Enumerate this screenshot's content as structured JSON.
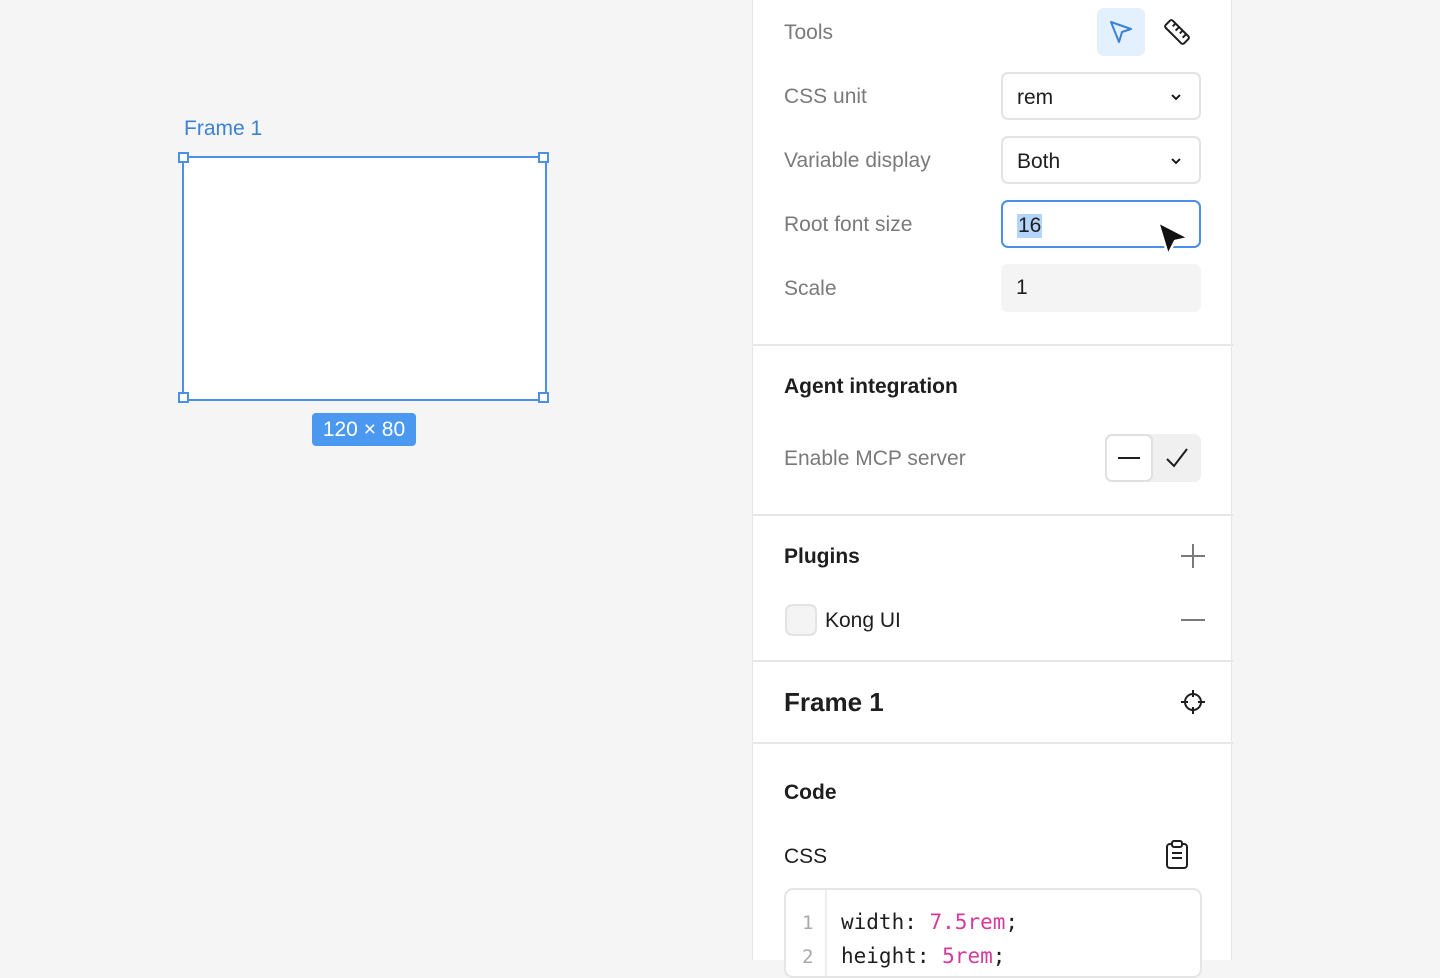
{
  "canvas": {
    "frame_label": "Frame 1",
    "dimensions_badge": "120 × 80"
  },
  "panel": {
    "tools": {
      "label": "Tools",
      "active_tool": "cursor-icon",
      "tools": [
        "cursor-icon",
        "ruler-icon"
      ]
    },
    "css_unit": {
      "label": "CSS unit",
      "value": "rem"
    },
    "variable_display": {
      "label": "Variable display",
      "value": "Both"
    },
    "root_font_size": {
      "label": "Root font size",
      "value": "16"
    },
    "scale": {
      "label": "Scale",
      "value": "1"
    },
    "agent_integration": {
      "title": "Agent integration",
      "enable_mcp": {
        "label": "Enable MCP server",
        "state": "off"
      }
    },
    "plugins": {
      "title": "Plugins",
      "items": [
        {
          "name": "Kong UI"
        }
      ]
    },
    "frame": {
      "title": "Frame 1"
    },
    "code": {
      "title": "Code",
      "css_label": "CSS",
      "lines": [
        {
          "number": "1",
          "property": "width",
          "value": "7.5rem"
        },
        {
          "number": "2",
          "property": "height",
          "value": "5rem"
        }
      ]
    }
  },
  "colors": {
    "accent": "#4a90e6",
    "badge": "#4a98f0",
    "code_value": "#d53a9d",
    "selection": "#b3d4fb"
  }
}
